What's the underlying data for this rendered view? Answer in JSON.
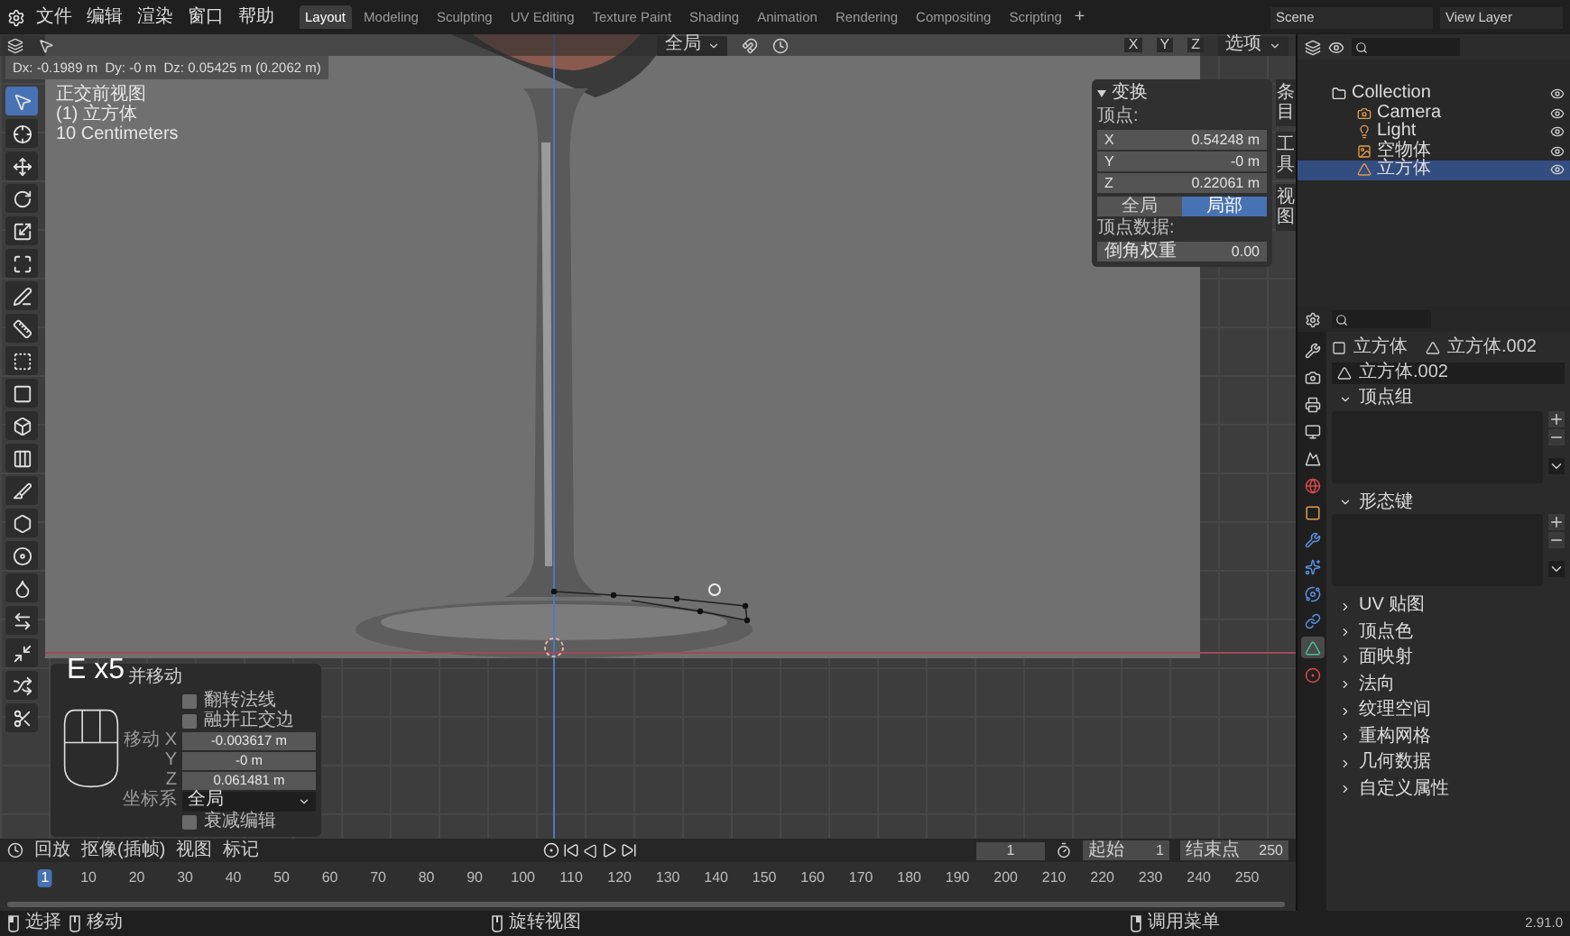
{
  "menu": {
    "items": [
      "文件",
      "编辑",
      "渲染",
      "窗口",
      "帮助"
    ]
  },
  "workspaces": [
    {
      "label": "Layout",
      "selected": true
    },
    {
      "label": "Modeling",
      "selected": false
    },
    {
      "label": "Sculpting",
      "selected": false
    },
    {
      "label": "UV Editing",
      "selected": false
    },
    {
      "label": "Texture Paint",
      "selected": false
    },
    {
      "label": "Shading",
      "selected": false
    },
    {
      "label": "Animation",
      "selected": false
    },
    {
      "label": "Rendering",
      "selected": false
    },
    {
      "label": "Compositing",
      "selected": false
    },
    {
      "label": "Scripting",
      "selected": false
    }
  ],
  "add_workspace": "+",
  "scene": "Scene",
  "view_layer": "View Layer",
  "viewport": {
    "pivot": "全局",
    "axes": [
      "X",
      "Y",
      "Z"
    ],
    "options": "选项",
    "readout": "Dx: -0.1989 m  Dy: -0 m  Dz: 0.05425 m (0.2062 m)",
    "overlay": [
      "正交前视图",
      "(1) 立方体",
      "10 Centimeters"
    ],
    "tools": [
      {
        "kind": "select",
        "selected": true
      },
      {
        "kind": "cursor",
        "selected": false
      },
      {
        "kind": "move",
        "selected": false
      },
      {
        "kind": "rotate",
        "selected": false
      },
      {
        "kind": "scale",
        "selected": false
      },
      {
        "kind": "transform",
        "selected": false
      },
      {
        "kind": "annotate",
        "selected": false
      },
      {
        "kind": "measure",
        "selected": false
      },
      {
        "kind": "extrude",
        "selected": false
      },
      {
        "kind": "inset",
        "selected": false
      },
      {
        "kind": "bevel",
        "selected": false
      },
      {
        "kind": "loopcut",
        "selected": false
      },
      {
        "kind": "knife",
        "selected": false
      },
      {
        "kind": "polybuild",
        "selected": false
      },
      {
        "kind": "spin",
        "selected": false
      },
      {
        "kind": "smooth",
        "selected": false
      },
      {
        "kind": "slide",
        "selected": false
      },
      {
        "kind": "shrink",
        "selected": false
      },
      {
        "kind": "shear",
        "selected": false
      },
      {
        "kind": "rip",
        "selected": false
      }
    ]
  },
  "n_panel": {
    "title": "变换",
    "vertex_label": "顶点:",
    "fields": [
      {
        "label": "X",
        "value": "0.54248 m"
      },
      {
        "label": "Y",
        "value": "-0 m"
      },
      {
        "label": "Z",
        "value": "0.22061 m"
      }
    ],
    "space": [
      {
        "label": "全局",
        "selected": false
      },
      {
        "label": "局部",
        "selected": true
      }
    ],
    "data_label": "顶点数据:",
    "bevel": {
      "label": "倒角权重",
      "value": "0.00"
    },
    "tabs": [
      "条目",
      "工具",
      "视图"
    ]
  },
  "operator_panel": {
    "key_overlay": "E x5",
    "title": "并移动",
    "checks": [
      {
        "label": "翻转法线",
        "checked": false
      },
      {
        "label": "融并正交边",
        "checked": false
      }
    ],
    "move": [
      {
        "label": "移动 X",
        "value": "-0.003617 m"
      },
      {
        "label": "Y",
        "value": "-0 m"
      },
      {
        "label": "Z",
        "value": "0.061481 m"
      }
    ],
    "orientation": {
      "label": "坐标系",
      "value": "全局"
    },
    "proportional": {
      "label": "衰减编辑",
      "checked": false
    }
  },
  "outliner": {
    "items": [
      {
        "name": "Collection",
        "kind": "collection",
        "selected": false,
        "children": [
          {
            "name": "Camera",
            "kind": "camera",
            "selected": false
          },
          {
            "name": "Light",
            "kind": "light",
            "selected": false
          },
          {
            "name": "空物体",
            "kind": "empty",
            "selected": false
          },
          {
            "name": "立方体",
            "kind": "mesh",
            "selected": true
          }
        ]
      }
    ]
  },
  "properties": {
    "object": "立方体",
    "mesh": "立方体.002",
    "datablock": "立方体.002",
    "tabs": [
      {
        "kind": "tool",
        "selected": false
      },
      {
        "kind": "render",
        "selected": false
      },
      {
        "kind": "output",
        "selected": false
      },
      {
        "kind": "view",
        "selected": false
      },
      {
        "kind": "scene",
        "selected": false
      },
      {
        "kind": "world",
        "selected": false
      },
      {
        "kind": "object",
        "selected": false
      },
      {
        "kind": "modifier",
        "selected": false
      },
      {
        "kind": "particles",
        "selected": false
      },
      {
        "kind": "physics",
        "selected": false
      },
      {
        "kind": "constraints",
        "selected": false
      },
      {
        "kind": "data",
        "selected": true
      },
      {
        "kind": "material",
        "selected": false
      }
    ],
    "panels": [
      {
        "title": "顶点组",
        "expanded": true
      },
      {
        "title": "形态键",
        "expanded": true
      },
      {
        "title": "UV 贴图",
        "expanded": false
      },
      {
        "title": "顶点色",
        "expanded": false
      },
      {
        "title": "面映射",
        "expanded": false
      },
      {
        "title": "法向",
        "expanded": false
      },
      {
        "title": "纹理空间",
        "expanded": false
      },
      {
        "title": "重构网格",
        "expanded": false
      },
      {
        "title": "几何数据",
        "expanded": false
      },
      {
        "title": "自定义属性",
        "expanded": false
      }
    ]
  },
  "timeline": {
    "menus": [
      "回放",
      "抠像(插帧)",
      "视图",
      "标记"
    ],
    "current_frame": "1",
    "start_label": "起始",
    "start": "1",
    "end_label": "结束点",
    "end": "250",
    "ticks": [
      {
        "label": "1",
        "selected": true
      },
      {
        "label": "10",
        "selected": false
      },
      {
        "label": "20",
        "selected": false
      },
      {
        "label": "30",
        "selected": false
      },
      {
        "label": "40",
        "selected": false
      },
      {
        "label": "50",
        "selected": false
      },
      {
        "label": "60",
        "selected": false
      },
      {
        "label": "70",
        "selected": false
      },
      {
        "label": "80",
        "selected": false
      },
      {
        "label": "90",
        "selected": false
      },
      {
        "label": "100",
        "selected": false
      },
      {
        "label": "110",
        "selected": false
      },
      {
        "label": "120",
        "selected": false
      },
      {
        "label": "130",
        "selected": false
      },
      {
        "label": "140",
        "selected": false
      },
      {
        "label": "150",
        "selected": false
      },
      {
        "label": "160",
        "selected": false
      },
      {
        "label": "170",
        "selected": false
      },
      {
        "label": "180",
        "selected": false
      },
      {
        "label": "190",
        "selected": false
      },
      {
        "label": "200",
        "selected": false
      },
      {
        "label": "210",
        "selected": false
      },
      {
        "label": "220",
        "selected": false
      },
      {
        "label": "230",
        "selected": false
      },
      {
        "label": "240",
        "selected": false
      },
      {
        "label": "250",
        "selected": false
      }
    ]
  },
  "status_bar": {
    "hints": [
      {
        "kind": "left",
        "label": "选择"
      },
      {
        "kind": "middle",
        "label": "移动"
      },
      {
        "kind": "middle",
        "label": "旋转视图"
      },
      {
        "kind": "right",
        "label": "调用菜单"
      }
    ],
    "version": "2.91.0"
  }
}
